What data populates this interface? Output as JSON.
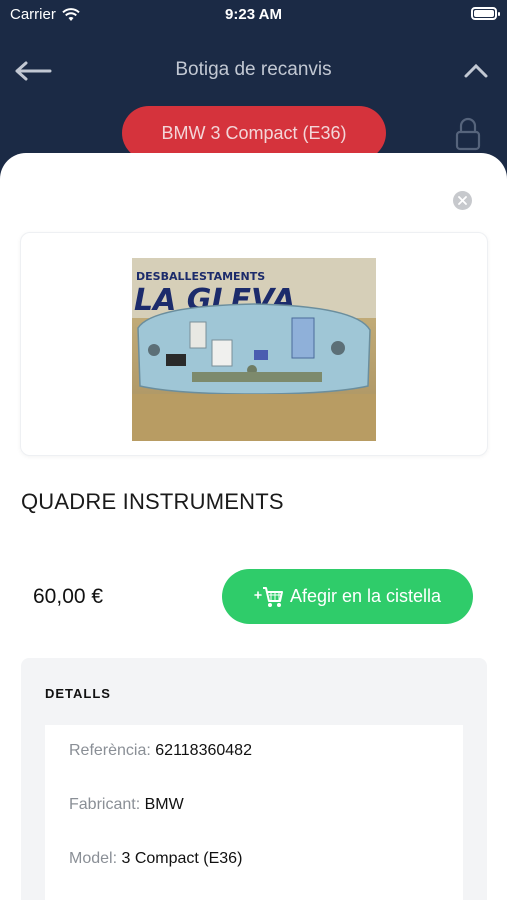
{
  "status_bar": {
    "carrier": "Carrier",
    "time": "9:23 AM"
  },
  "nav": {
    "title": "Botiga de recanvis",
    "back_icon": "arrow-left-icon",
    "collapse_icon": "chevron-up-icon"
  },
  "vehicle": {
    "label": "BMW 3 Compact (E36)",
    "lock_icon": "lock-icon"
  },
  "product": {
    "name": "QUADRE INSTRUMENTS",
    "price": "60,00 €",
    "add_to_cart_label": "Afegir en la cistella",
    "photo_text_top": "DESBALLESTAMENTS",
    "photo_text_brand": "LA GLEVA"
  },
  "details": {
    "title": "DETALLS",
    "rows": [
      {
        "key": "Referència:",
        "value": "62118360482"
      },
      {
        "key": "Fabricant:",
        "value": "BMW"
      },
      {
        "key": "Model:",
        "value": "3 Compact (E36)"
      }
    ]
  },
  "colors": {
    "header_bg": "#1b2a45",
    "pill_red": "#d5333c",
    "cart_green": "#2fcc6a"
  }
}
